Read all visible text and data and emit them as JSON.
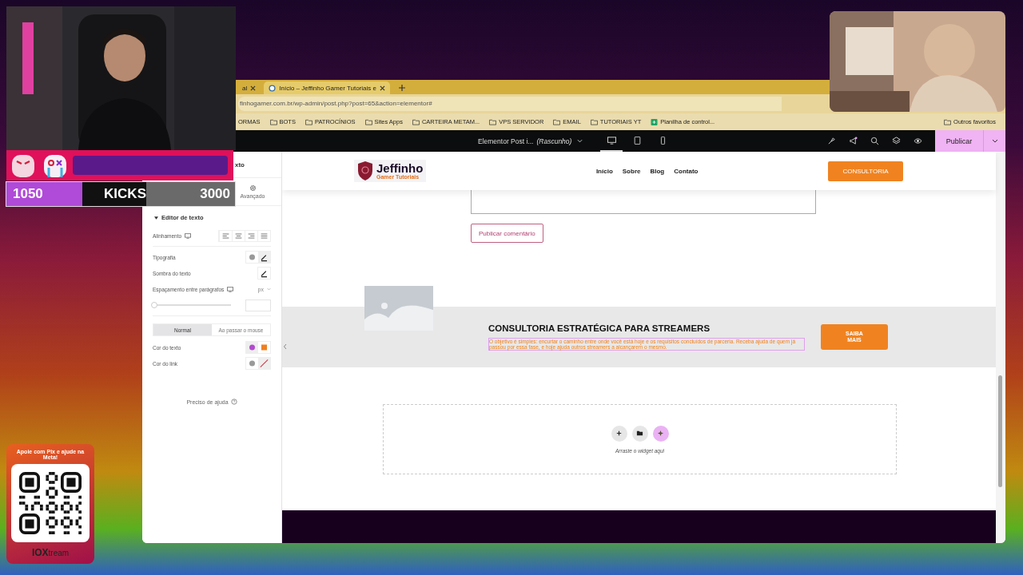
{
  "stream_overlay": {
    "kicks": {
      "current": "1050",
      "label": "KICKS",
      "goal": "3000"
    },
    "pix_card": {
      "title": "Apoie com Pix e ajude na Meta!",
      "brand_bold": "IOX",
      "brand_rest": "tream"
    }
  },
  "browser": {
    "tabs": [
      {
        "label": "al",
        "selected": false
      },
      {
        "label": "Início – Jeffinho Gamer Tutoriais e",
        "selected": true
      }
    ],
    "address": "finhogamer.com.br/wp-admin/post.php?post=65&action=elementor#",
    "bookmarks": [
      {
        "label": "ORMAS",
        "kind": "plain"
      },
      {
        "label": "BOTS",
        "kind": "folder"
      },
      {
        "label": "PATROCÍNIOS",
        "kind": "folder"
      },
      {
        "label": "Sites Apps",
        "kind": "folder"
      },
      {
        "label": "CARTEIRA METAM...",
        "kind": "folder"
      },
      {
        "label": "VPS SERVIDOR",
        "kind": "folder"
      },
      {
        "label": "EMAIL",
        "kind": "folder"
      },
      {
        "label": "TUTORIAIS YT",
        "kind": "folder"
      },
      {
        "label": "Planilha de control...",
        "kind": "sheet"
      }
    ],
    "other_bookmarks": "Outros favoritos"
  },
  "editor_bar": {
    "document_title": "Elementor Post i...",
    "status": "(Rascunho)",
    "devices": [
      {
        "kind": "desktop",
        "selected": true
      },
      {
        "kind": "tablet",
        "selected": false
      },
      {
        "kind": "mobile",
        "selected": false
      }
    ],
    "publish": "Publicar"
  },
  "panel": {
    "title": "xto",
    "tab": "Avançado",
    "section": "Editor de texto",
    "alignment": "Alinhamento",
    "typography": "Tipografia",
    "text_shadow": "Sombra do texto",
    "spacing": {
      "label": "Espaçamento entre parágrafos",
      "unit": "px",
      "level": 0
    },
    "state_tabs": [
      {
        "label": "Normal",
        "selected": true
      },
      {
        "label": "Ao passar o mouse",
        "selected": false
      }
    ],
    "colors": [
      {
        "label": "Cor do texto",
        "global": true,
        "color": "#f07f1e"
      },
      {
        "label": "Cor do link",
        "global": false
      }
    ],
    "help": "Preciso de ajuda"
  },
  "site": {
    "logo_title": "Jeffinho",
    "logo_subtitle": "Gamer Tutoriais",
    "nav": [
      "Início",
      "Sobre",
      "Blog",
      "Contato"
    ],
    "cta": "CONSULTORIA",
    "comment_button": "Publicar comentário",
    "banner": {
      "heading": "CONSULTORIA ESTRATÉGICA PARA STREAMERS",
      "text": "O objetivo é simples: encurtar o caminho entre onde você está hoje e os requisitos concluídos de parceria. Receba ajuda de quem já passou por essa fase, e hoje ajuda outros streamers a alcançarem o mesmo.",
      "button": "SAIBA MAIS"
    },
    "drop_zone": "Arraste o widget aqui"
  }
}
